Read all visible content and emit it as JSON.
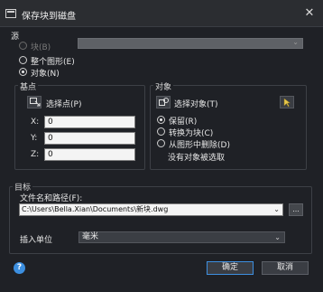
{
  "window": {
    "title": "保存块到磁盘"
  },
  "source": {
    "label": "源",
    "options": [
      {
        "label": "块(B)",
        "selected": false,
        "disabled": true
      },
      {
        "label": "整个图形(E)",
        "selected": false,
        "disabled": false
      },
      {
        "label": "对象(N)",
        "selected": true,
        "disabled": false
      }
    ]
  },
  "base_point": {
    "label": "基点",
    "pick_label": "选择点(P)",
    "x_label": "X:",
    "y_label": "Y:",
    "z_label": "Z:",
    "x_value": "0",
    "y_value": "0",
    "z_value": "0"
  },
  "objects": {
    "label": "对象",
    "select_label": "选择对象(T)",
    "options": [
      {
        "label": "保留(R)",
        "selected": true
      },
      {
        "label": "转换为块(C)",
        "selected": false
      },
      {
        "label": "从图形中删除(D)",
        "selected": false
      }
    ],
    "status": "没有对象被选取"
  },
  "target": {
    "label": "目标",
    "path_label": "文件名和路径(F):",
    "path_value": "C:\\Users\\Bella.Xian\\Documents\\新块.dwg",
    "browse_label": "...",
    "unit_label": "插入单位",
    "unit_value": "毫米"
  },
  "buttons": {
    "ok": "确定",
    "cancel": "取消",
    "help": "?"
  },
  "colors": {
    "accent": "#3d8fe0",
    "background": "#1f2126"
  }
}
